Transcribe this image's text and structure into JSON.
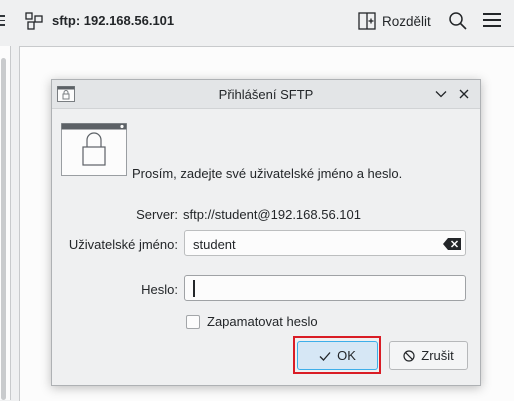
{
  "toolbar": {
    "title": "sftp: 192.168.56.101",
    "split_label": "Rozdělit"
  },
  "dialog": {
    "title": "Přihlášení SFTP",
    "prompt": "Prosím, zadejte své uživatelské jméno a heslo.",
    "server_label": "Server:",
    "server_value": "sftp://student@192.168.56.101",
    "username_label": "Uživatelské jméno:",
    "username_value": "student",
    "password_label": "Heslo:",
    "password_value": "",
    "remember_label": "Zapamatovat heslo",
    "remember_checked": false,
    "ok_label": "OK",
    "cancel_label": "Zrušit"
  },
  "icons": {
    "menu": "menu-icon",
    "split_view": "split-view-icon",
    "split": "split-icon",
    "search": "search-icon",
    "hamburger": "hamburger-icon",
    "app": "lock-window-icon",
    "minimize": "chevron-down-icon",
    "close": "close-icon",
    "clear": "clear-text-icon",
    "ok": "checkmark-icon",
    "cancel": "cancel-icon"
  },
  "colors": {
    "accent": "#3daee9",
    "highlight": "#d91c25",
    "ok_fill": "#d6e7f5"
  }
}
